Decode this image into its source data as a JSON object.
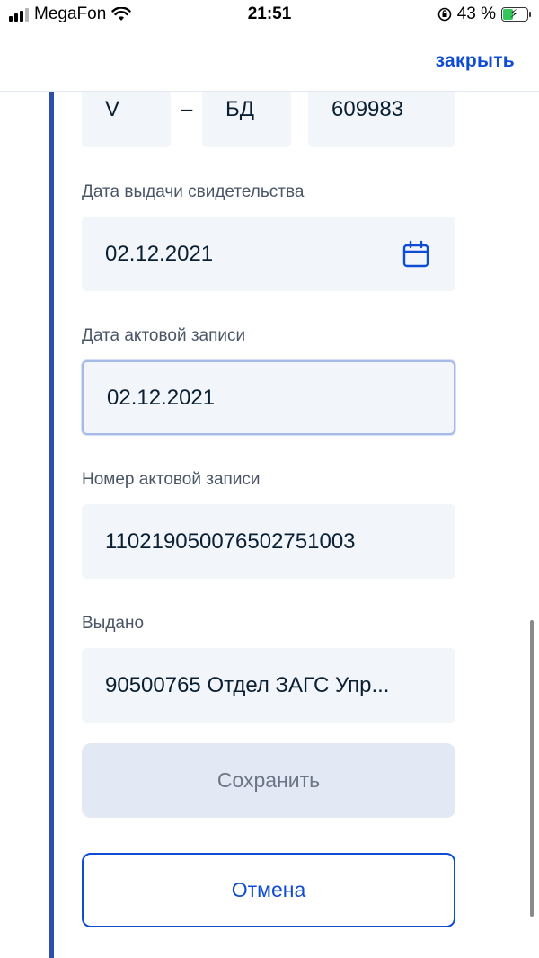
{
  "status_bar": {
    "carrier": "MegaFon",
    "time": "21:51",
    "battery_percent": "43 %",
    "battery_level": 0.43
  },
  "header": {
    "close_label": "закрыть"
  },
  "series_row": {
    "part1": "V",
    "dash": "–",
    "part2": "БД",
    "number": "609983"
  },
  "issue_date": {
    "label": "Дата выдачи свидетельства",
    "value": "02.12.2021"
  },
  "record_date": {
    "label": "Дата актовой записи",
    "value": "02.12.2021"
  },
  "record_number": {
    "label": "Номер актовой записи",
    "value": "110219050076502751003"
  },
  "issued_by": {
    "label": "Выдано",
    "value": "90500765 Отдел ЗАГС Упр..."
  },
  "buttons": {
    "save": "Сохранить",
    "cancel": "Отмена"
  },
  "colors": {
    "accent": "#0d4cd3",
    "field_bg": "#f2f5f9",
    "card_border": "#2d4fa8"
  }
}
